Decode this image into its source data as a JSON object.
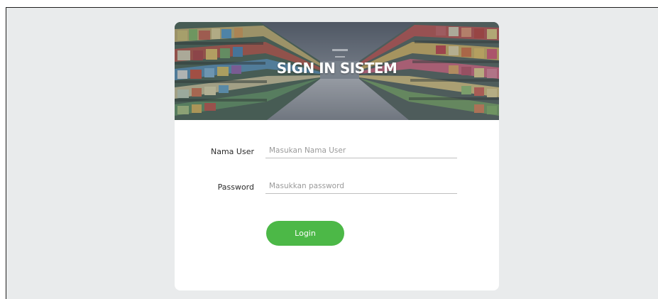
{
  "banner": {
    "title": "SIGN IN SISTEM",
    "image": "supermarket-aisle-image"
  },
  "form": {
    "username": {
      "label": "Nama User",
      "placeholder": "Masukan Nama User",
      "value": ""
    },
    "password": {
      "label": "Password",
      "placeholder": "Masukkan password",
      "value": ""
    },
    "submit_label": "Login"
  },
  "colors": {
    "page_background": "#e9ebec",
    "card_background": "#ffffff",
    "accent_green": "#4cb847",
    "input_underline": "#bfbfbf"
  }
}
